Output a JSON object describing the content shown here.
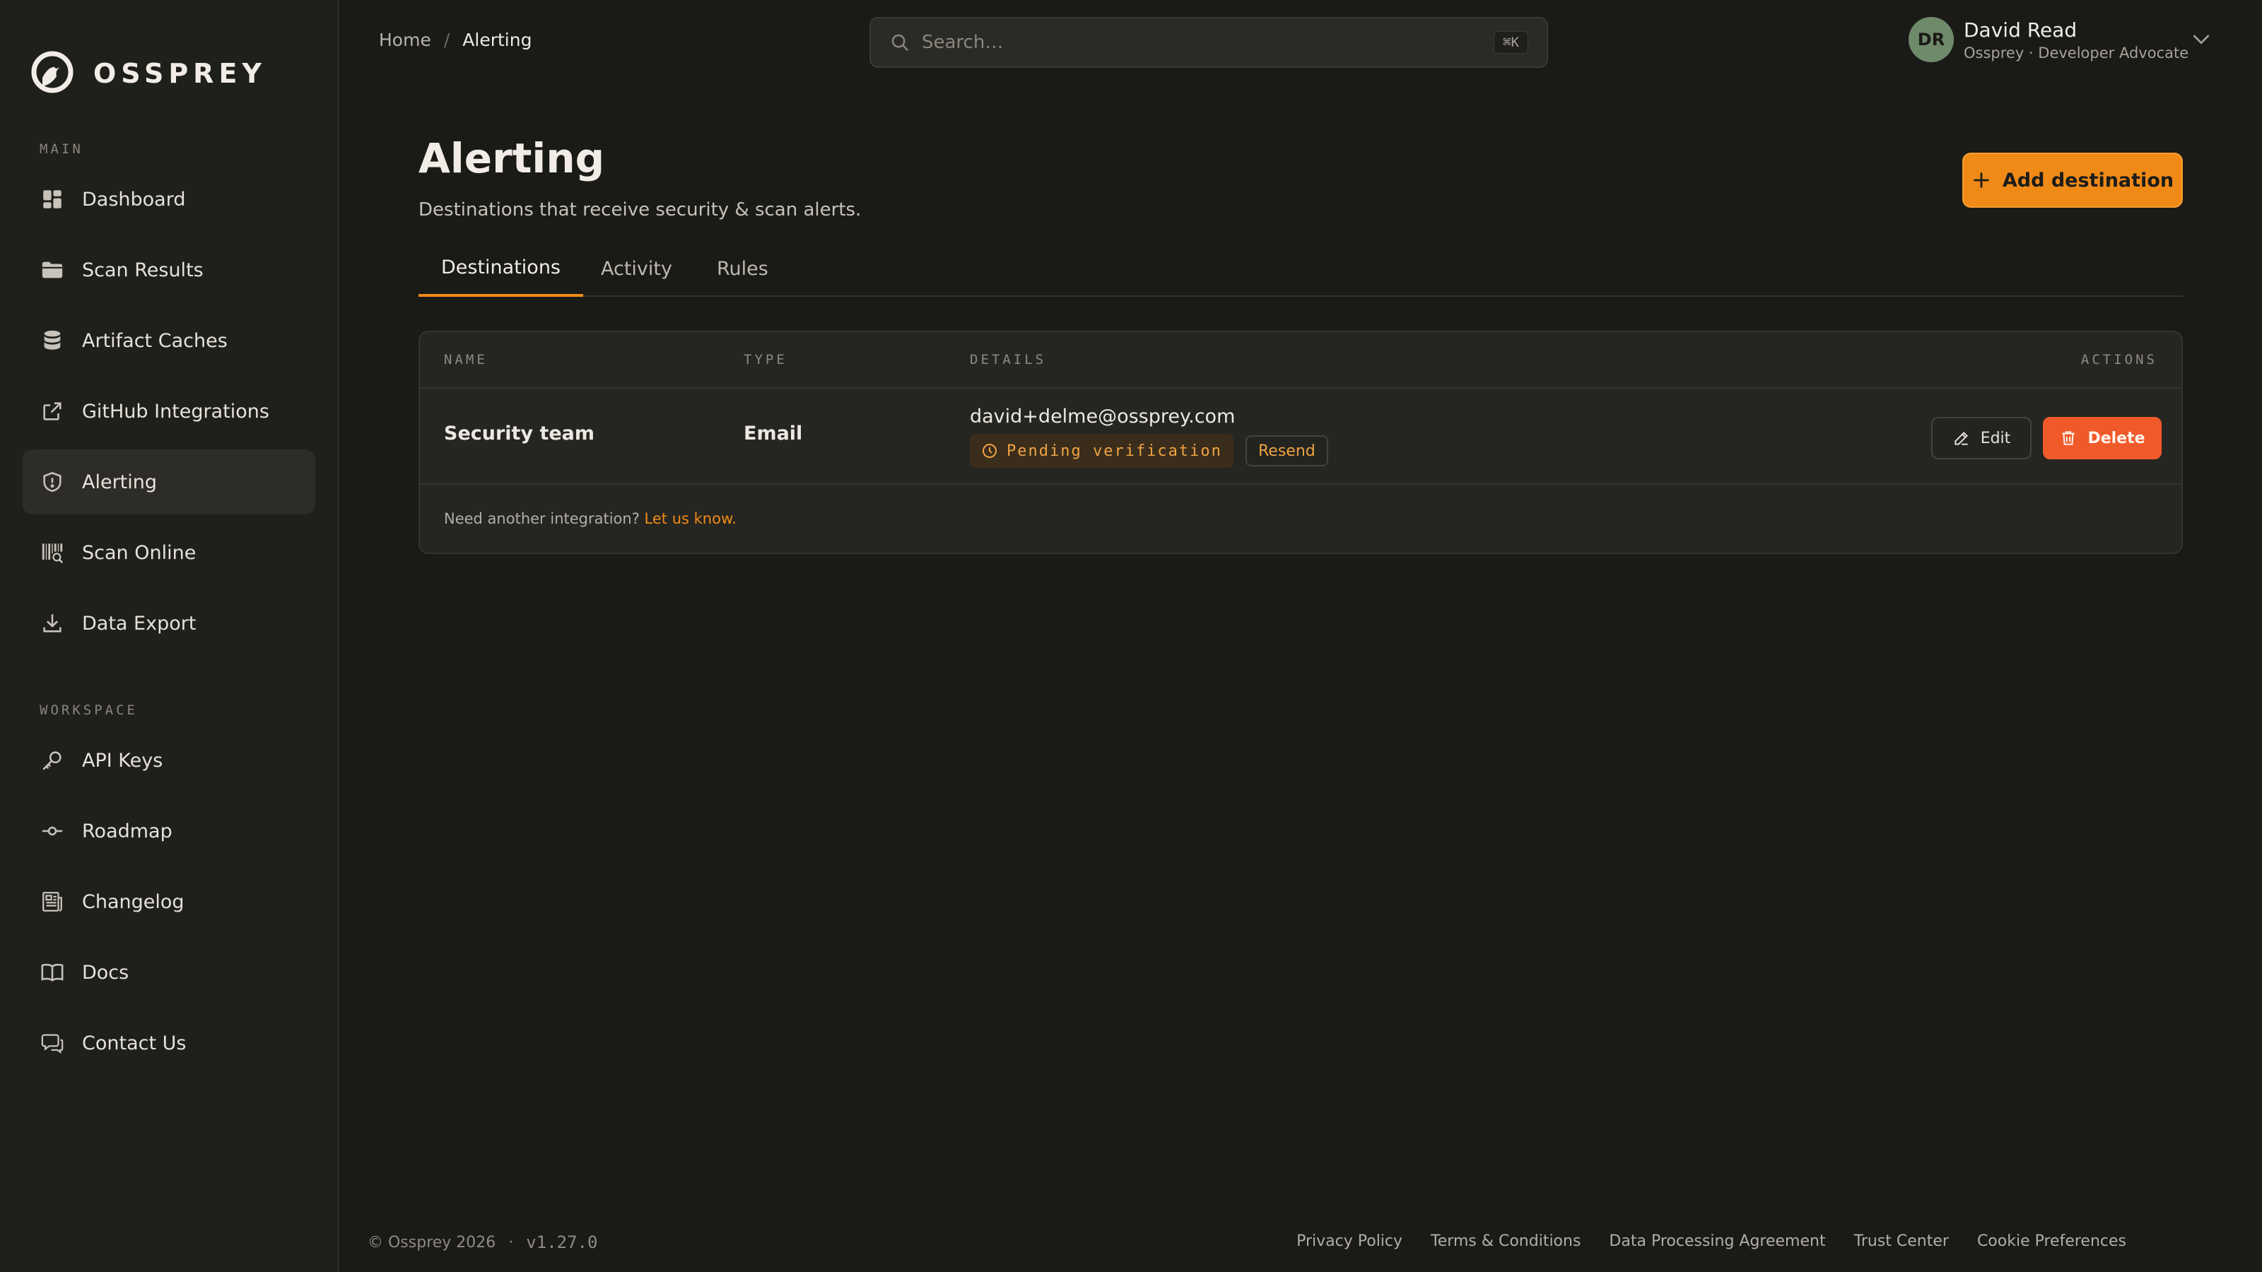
{
  "brand": {
    "name": "OSSPREY"
  },
  "sidebar": {
    "main_label": "MAIN",
    "workspace_label": "WORKSPACE",
    "main_items": [
      {
        "label": "Dashboard",
        "icon": "dashboard-icon"
      },
      {
        "label": "Scan Results",
        "icon": "folder-icon"
      },
      {
        "label": "Artifact Caches",
        "icon": "database-icon"
      },
      {
        "label": "GitHub Integrations",
        "icon": "external-link-icon"
      },
      {
        "label": "Alerting",
        "icon": "shield-icon",
        "active": true
      },
      {
        "label": "Scan Online",
        "icon": "barcode-scan-icon"
      },
      {
        "label": "Data Export",
        "icon": "download-icon"
      }
    ],
    "workspace_items": [
      {
        "label": "API Keys",
        "icon": "key-icon"
      },
      {
        "label": "Roadmap",
        "icon": "commit-icon"
      },
      {
        "label": "Changelog",
        "icon": "newspaper-icon"
      },
      {
        "label": "Docs",
        "icon": "book-icon"
      },
      {
        "label": "Contact Us",
        "icon": "chat-icon"
      }
    ]
  },
  "breadcrumb": {
    "home": "Home",
    "separator": "/",
    "current": "Alerting"
  },
  "search": {
    "placeholder": "Search…",
    "shortcut": "⌘K"
  },
  "user": {
    "initials": "DR",
    "name": "David Read",
    "subtitle": "Ossprey · Developer Advocate"
  },
  "page": {
    "title": "Alerting",
    "subtitle": "Destinations that receive security & scan alerts.",
    "add_button": "Add destination"
  },
  "tabs": [
    {
      "label": "Destinations",
      "active": true
    },
    {
      "label": "Activity"
    },
    {
      "label": "Rules"
    }
  ],
  "table": {
    "columns": {
      "name": "NAME",
      "type": "TYPE",
      "details": "DETAILS",
      "actions": "ACTIONS"
    },
    "rows": [
      {
        "name": "Security team",
        "type": "Email",
        "detail": "david+delme@ossprey.com",
        "status": "Pending verification",
        "resend": "Resend",
        "edit": "Edit",
        "delete": "Delete"
      }
    ],
    "footnote": "Need another integration?",
    "footnote_link": "Let us know."
  },
  "footer": {
    "copyright": "© Ossprey 2026",
    "dot": "·",
    "version": "v1.27.0",
    "links": [
      "Privacy Policy",
      "Terms & Conditions",
      "Data Processing Agreement",
      "Trust Center",
      "Cookie Preferences"
    ]
  },
  "colors": {
    "accent": "#f08a17",
    "danger": "#f05a2a",
    "background": "#1a1a17",
    "sidebar": "#1f1f1c"
  }
}
